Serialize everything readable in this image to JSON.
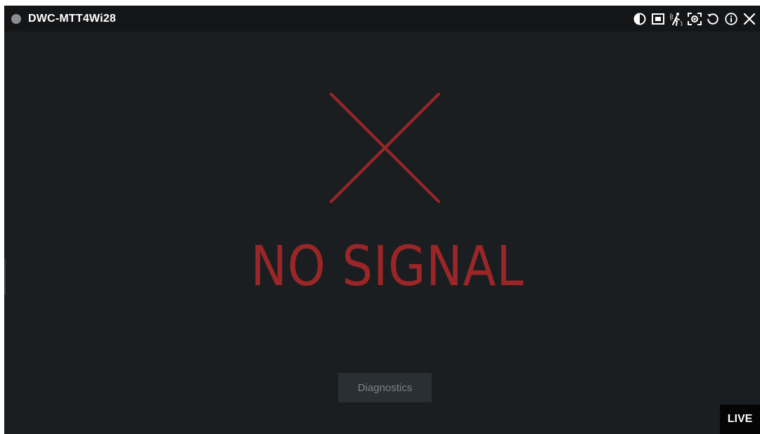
{
  "camera": {
    "name": "DWC-MTT4Wi28",
    "status_color": "#8b8d90"
  },
  "toolbar": {
    "icons": [
      {
        "name": "contrast-icon"
      },
      {
        "name": "fit-window-icon"
      },
      {
        "name": "motion-detection-icon"
      },
      {
        "name": "snapshot-icon"
      },
      {
        "name": "refresh-icon"
      },
      {
        "name": "info-icon"
      },
      {
        "name": "close-icon"
      }
    ]
  },
  "video": {
    "message": "NO SIGNAL",
    "message_color": "#9b2628",
    "diagnostics_label": "Diagnostics",
    "live_label": "LIVE"
  }
}
